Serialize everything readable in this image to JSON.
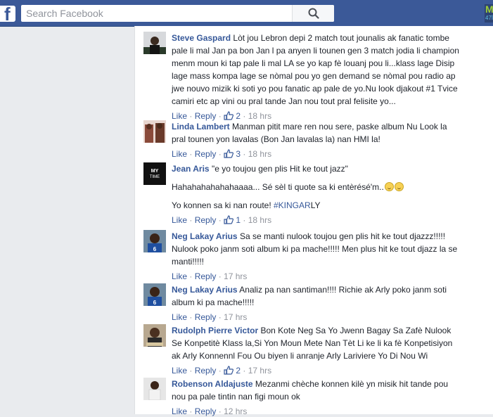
{
  "search": {
    "placeholder": "Search Facebook"
  },
  "ad_badge": {
    "line1": "M",
    "line2": "47İ"
  },
  "comments": [
    {
      "author": "Steve Gaspard",
      "text": "Lòt jou Lebron depi 2 match tout jounalis ak fanatic tombe pale li mal Jan pa bon Jan l pa anyen li tounen gen 3 match jodia li champion menm moun ki tap pale li mal LA se yo kap fè louanj pou li...klass lage Disip lage mass kompa lage se nòmal pou yo gen demand se nòmal pou radio ap jwe nouvo mizik ki soti yo pou fanatic ap pale de yo.Nu look djakout #1 Tvice camiri etc ap vini ou pral tande Jan nou tout pral felisite yo...",
      "like": "Like",
      "reply": "Reply",
      "likes": "2",
      "time": "18 hrs"
    },
    {
      "author": "Linda Lambert",
      "text": "Manman pitit mare ren nou sere, paske album Nu Look la pral tounen yon lavalas (Bon Jan lavalas la) nan HMI la!",
      "like": "Like",
      "reply": "Reply",
      "likes": "3",
      "time": "18 hrs"
    },
    {
      "author": "Jean Aris",
      "text": "\"e yo toujou gen plis Hit ke tout jazz\"",
      "text2": "Hahahahahahahaaaa... Sé sèl ti quote sa ki entèrésé'm..",
      "text3_pre": "Yo konnen sa ki nan route! ",
      "text3_tag": "#KINGAR",
      "text3_post": "LY",
      "like": "Like",
      "reply": "Reply",
      "likes": "1",
      "time": "18 hrs"
    },
    {
      "author": "Neg Lakay Arius",
      "text": "Sa se manti nulook toujou gen plis hit ke tout djazzz!!!!! Nulook poko janm soti album ki pa mache!!!!! Men plus hit ke tout djazz la se manti!!!!!",
      "like": "Like",
      "reply": "Reply",
      "time": "17 hrs"
    },
    {
      "author": "Neg Lakay Arius",
      "text": "Analiz pa nan santiman!!!! Richie ak Arly poko janm soti album ki pa mache!!!!!",
      "like": "Like",
      "reply": "Reply",
      "time": "17 hrs"
    },
    {
      "author": "Rudolph Pierre Victor",
      "text": "Bon Kote Neg Sa Yo Jwenn Bagay Sa Zafè Nulook Se Konpetitè Klass la,Si Yon Moun Mete Nan Tèt Li ke li ka fè Konpetisiyon ak Arly Konnennl Fou Ou biyen li anranje Arly Lariviere Yo Di Nou Wi",
      "like": "Like",
      "reply": "Reply",
      "likes": "2",
      "time": "17 hrs"
    },
    {
      "author": "Robenson Aldajuste",
      "text": "Mezanmi chèche konnen kilè yn misik hit tande pou nou pa pale tintin nan figi moun ok",
      "like": "Like",
      "reply": "Reply",
      "time": "12 hrs"
    }
  ],
  "colors": {
    "header": "#3b5998",
    "link": "#365899",
    "meta": "#90949c",
    "background": "#e9ebee"
  }
}
